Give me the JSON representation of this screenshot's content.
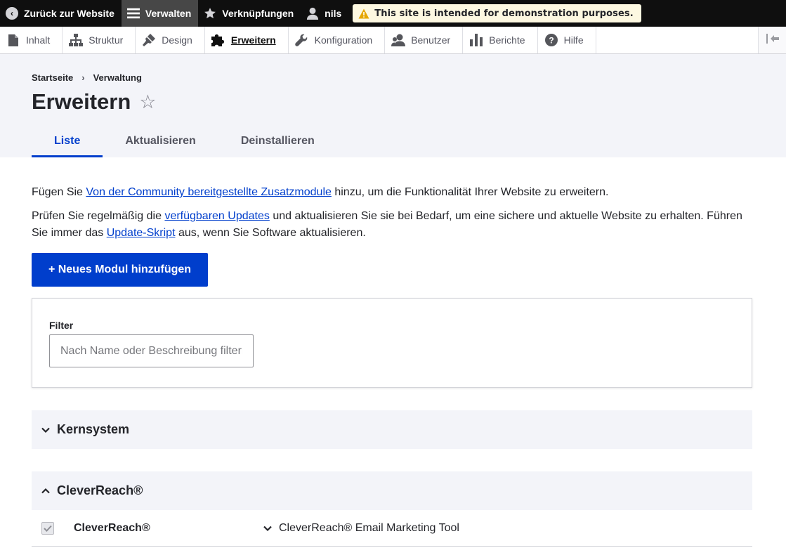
{
  "toolbar": {
    "back_label": "Zurück zur Website",
    "manage_label": "Verwalten",
    "shortcuts_label": "Verknüpfungen",
    "user_label": "nils",
    "demo_notice": "This site is intended for demonstration purposes."
  },
  "tray": {
    "items": [
      {
        "label": "Inhalt",
        "icon": "file-icon"
      },
      {
        "label": "Struktur",
        "icon": "structure-icon"
      },
      {
        "label": "Design",
        "icon": "paintbrush-icon"
      },
      {
        "label": "Erweitern",
        "icon": "puzzle-icon",
        "active": true
      },
      {
        "label": "Konfiguration",
        "icon": "wrench-icon"
      },
      {
        "label": "Benutzer",
        "icon": "people-icon"
      },
      {
        "label": "Berichte",
        "icon": "bar-chart-icon"
      },
      {
        "label": "Hilfe",
        "icon": "help-icon"
      }
    ]
  },
  "breadcrumb": {
    "home": "Startseite",
    "separator": "›",
    "admin": "Verwaltung"
  },
  "page": {
    "title": "Erweitern",
    "star": "☆"
  },
  "tabs": [
    {
      "label": "Liste",
      "active": true
    },
    {
      "label": "Aktualisieren"
    },
    {
      "label": "Deinstallieren"
    }
  ],
  "intro": {
    "p1_before": "Fügen Sie ",
    "p1_link": "Von der Community bereitgestellte Zusatzmodule",
    "p1_after": " hinzu, um die Funktionalität Ihrer Website zu erweitern.",
    "p2_before": "Prüfen Sie regelmäßig die ",
    "p2_link": "verfügbaren Updates",
    "p2_middle": " und aktualisieren Sie sie bei Bedarf, um eine sichere und aktuelle Website zu erhalten. Führen Sie immer das ",
    "p2_link2": "Update-Skript",
    "p2_after": " aus, wenn Sie Software aktualisieren."
  },
  "add_module_button": "+ Neues Modul hinzufügen",
  "filter": {
    "label": "Filter",
    "placeholder": "Nach Name oder Beschreibung filtern",
    "value": ""
  },
  "groups": [
    {
      "title": "Kernsystem",
      "expanded": false
    },
    {
      "title": "CleverReach®",
      "expanded": true
    }
  ],
  "module": {
    "name": "CleverReach®",
    "description": "CleverReach® Email Marketing Tool",
    "checked": true
  },
  "colors": {
    "accent": "#003ecc",
    "toolbar_bg": "#0f0f0f",
    "header_bg": "#f3f4f9",
    "notice_bg": "#fdf8e1",
    "warning": "#e6a700"
  }
}
